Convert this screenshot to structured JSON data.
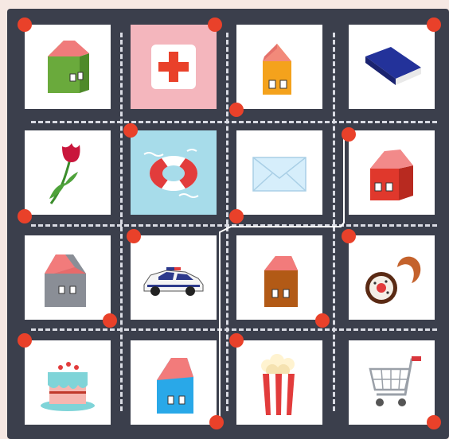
{
  "board": {
    "tiles": [
      {
        "name": "house-green-tile",
        "icon": "house-icon",
        "roof": "#f07b7b",
        "wall": "#6aaa3c",
        "side": "#4e8a2a"
      },
      {
        "name": "hospital-tile",
        "icon": "medical-cross-icon",
        "bg": "#f4b6bd",
        "accent": "#e9412a"
      },
      {
        "name": "house-orange-tile",
        "icon": "house-icon",
        "roof": "#f28a7a",
        "wall": "#f4a21c",
        "side": "#e08a0e"
      },
      {
        "name": "book-tile",
        "icon": "book-icon",
        "accent": "#23329a"
      },
      {
        "name": "tulip-tile",
        "icon": "tulip-icon",
        "accent": "#c9163c"
      },
      {
        "name": "swimming-pool-tile",
        "icon": "life-ring-icon",
        "bg": "#a7dcea",
        "accent": "#e23c3c"
      },
      {
        "name": "mail-tile",
        "icon": "envelope-icon",
        "accent": "#bfe3f5"
      },
      {
        "name": "house-red-tile",
        "icon": "house-icon",
        "roof": "#f28a8a",
        "wall": "#e0382c",
        "side": "#b82a20"
      },
      {
        "name": "house-gray-tile",
        "icon": "house-icon",
        "roof": "#f27b7b",
        "wall": "#8a8e96",
        "side": "#6e727a"
      },
      {
        "name": "police-car-tile",
        "icon": "police-car-icon",
        "accent": "#2d3a8c"
      },
      {
        "name": "house-brown-tile",
        "icon": "house-icon",
        "roof": "#f27b7b",
        "wall": "#b25a16",
        "side": "#8f4510"
      },
      {
        "name": "bakery-tile",
        "icon": "donut-icon",
        "accent": "#c4622c"
      },
      {
        "name": "cake-tile",
        "icon": "cake-icon",
        "accent": "#7fd4d8"
      },
      {
        "name": "house-blue-tile",
        "icon": "house-icon",
        "roof": "#f27b7b",
        "wall": "#29a8e8",
        "side": "#1c86c2"
      },
      {
        "name": "popcorn-tile",
        "icon": "popcorn-icon",
        "accent": "#e23c3c"
      },
      {
        "name": "shopping-cart-tile",
        "icon": "shopping-cart-icon",
        "accent": "#d9363c"
      }
    ],
    "markers": [
      {
        "name": "marker-a1",
        "col": 0,
        "row": 0
      },
      {
        "name": "marker-b1",
        "col": 2,
        "row": 0
      },
      {
        "name": "marker-c1",
        "col": 4,
        "row": 0
      },
      {
        "name": "marker-d1",
        "col": 2,
        "row": 1
      },
      {
        "name": "marker-e1",
        "col": 1,
        "row": 1
      },
      {
        "name": "marker-f1",
        "col": 3,
        "row": 1
      },
      {
        "name": "marker-a2",
        "col": 0,
        "row": 2
      },
      {
        "name": "marker-b2",
        "col": 2,
        "row": 2
      },
      {
        "name": "marker-c2",
        "col": 1,
        "row": 2
      },
      {
        "name": "marker-d2",
        "col": 3,
        "row": 2
      },
      {
        "name": "marker-a3",
        "col": 1,
        "row": 3
      },
      {
        "name": "marker-b3",
        "col": 3,
        "row": 3
      },
      {
        "name": "marker-a4",
        "col": 0,
        "row": 3
      },
      {
        "name": "marker-b4",
        "col": 2,
        "row": 3
      },
      {
        "name": "marker-c4",
        "col": 2,
        "row": 4
      },
      {
        "name": "marker-d4",
        "col": 4,
        "row": 4
      }
    ],
    "colors": {
      "board": "#3b3f4c",
      "road_dash": "#d9dbe3",
      "marker": "#e9412a",
      "route": "#ffffff"
    }
  }
}
